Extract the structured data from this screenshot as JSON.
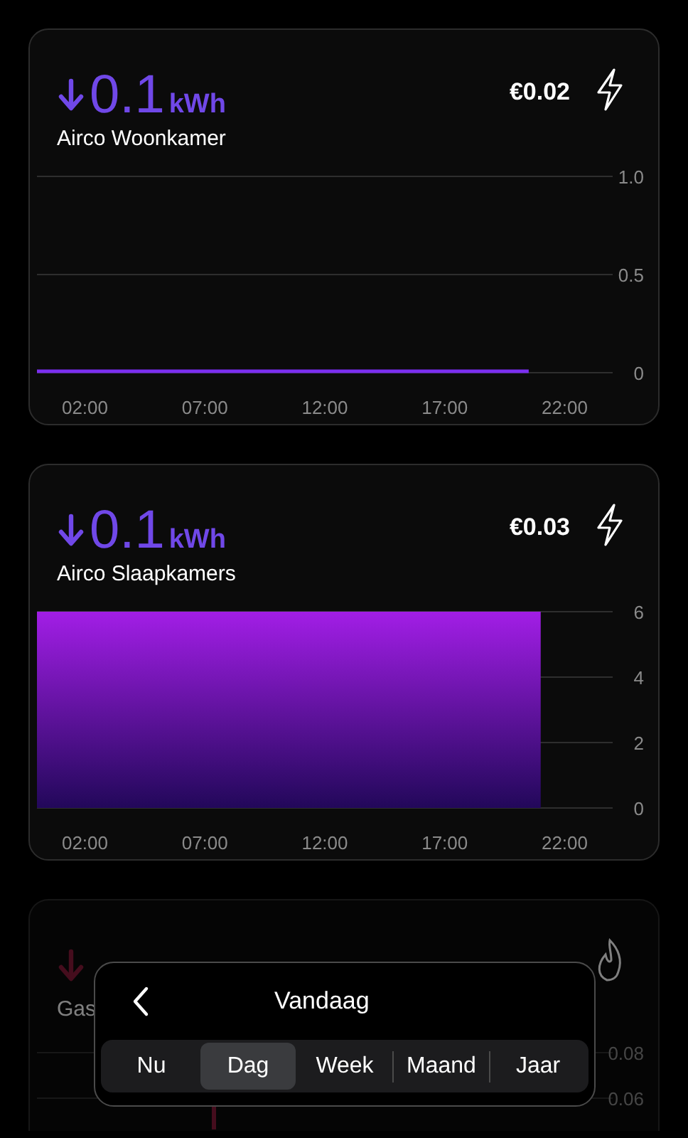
{
  "cards": [
    {
      "kind": "electricity",
      "value": "0.1",
      "unit": "kWh",
      "name": "Airco Woonkamer",
      "cost": "€0.02",
      "chart_data": {
        "type": "line",
        "x": [
          0,
          20.5
        ],
        "series": [
          {
            "color": "#7b2ff0",
            "values": [
              0,
              0
            ]
          }
        ],
        "xlim": [
          0,
          24
        ],
        "ylim": [
          0,
          1
        ],
        "xticks": [
          {
            "value": 2,
            "label": "02:00"
          },
          {
            "value": 7,
            "label": "07:00"
          },
          {
            "value": 12,
            "label": "12:00"
          },
          {
            "value": 17,
            "label": "17:00"
          },
          {
            "value": 22,
            "label": "22:00"
          }
        ],
        "yticks": [
          {
            "value": 0,
            "label": "0"
          },
          {
            "value": 0.5,
            "label": "0.5"
          },
          {
            "value": 1,
            "label": "1.0"
          }
        ]
      }
    },
    {
      "kind": "electricity",
      "value": "0.1",
      "unit": "kWh",
      "name": "Airco Slaapkamers",
      "cost": "€0.03",
      "chart_data": {
        "type": "area",
        "x": [
          0,
          21
        ],
        "series": [
          {
            "color": "#a21ee6",
            "values": [
              6,
              6
            ]
          }
        ],
        "xlim": [
          0,
          24
        ],
        "ylim": [
          0,
          6
        ],
        "xticks": [
          {
            "value": 2,
            "label": "02:00"
          },
          {
            "value": 7,
            "label": "07:00"
          },
          {
            "value": 12,
            "label": "12:00"
          },
          {
            "value": 17,
            "label": "17:00"
          },
          {
            "value": 22,
            "label": "22:00"
          }
        ],
        "yticks": [
          0,
          2,
          4,
          6
        ]
      }
    },
    {
      "kind": "gas",
      "name": "Gas",
      "y_tick_labels": [
        "0.08",
        "0.06"
      ]
    }
  ],
  "period_picker": {
    "title": "Vandaag",
    "options": [
      {
        "label": "Nu",
        "selected": false
      },
      {
        "label": "Dag",
        "selected": true
      },
      {
        "label": "Week",
        "selected": false
      },
      {
        "label": "Maand",
        "selected": false
      },
      {
        "label": "Jaar",
        "selected": false
      }
    ]
  }
}
